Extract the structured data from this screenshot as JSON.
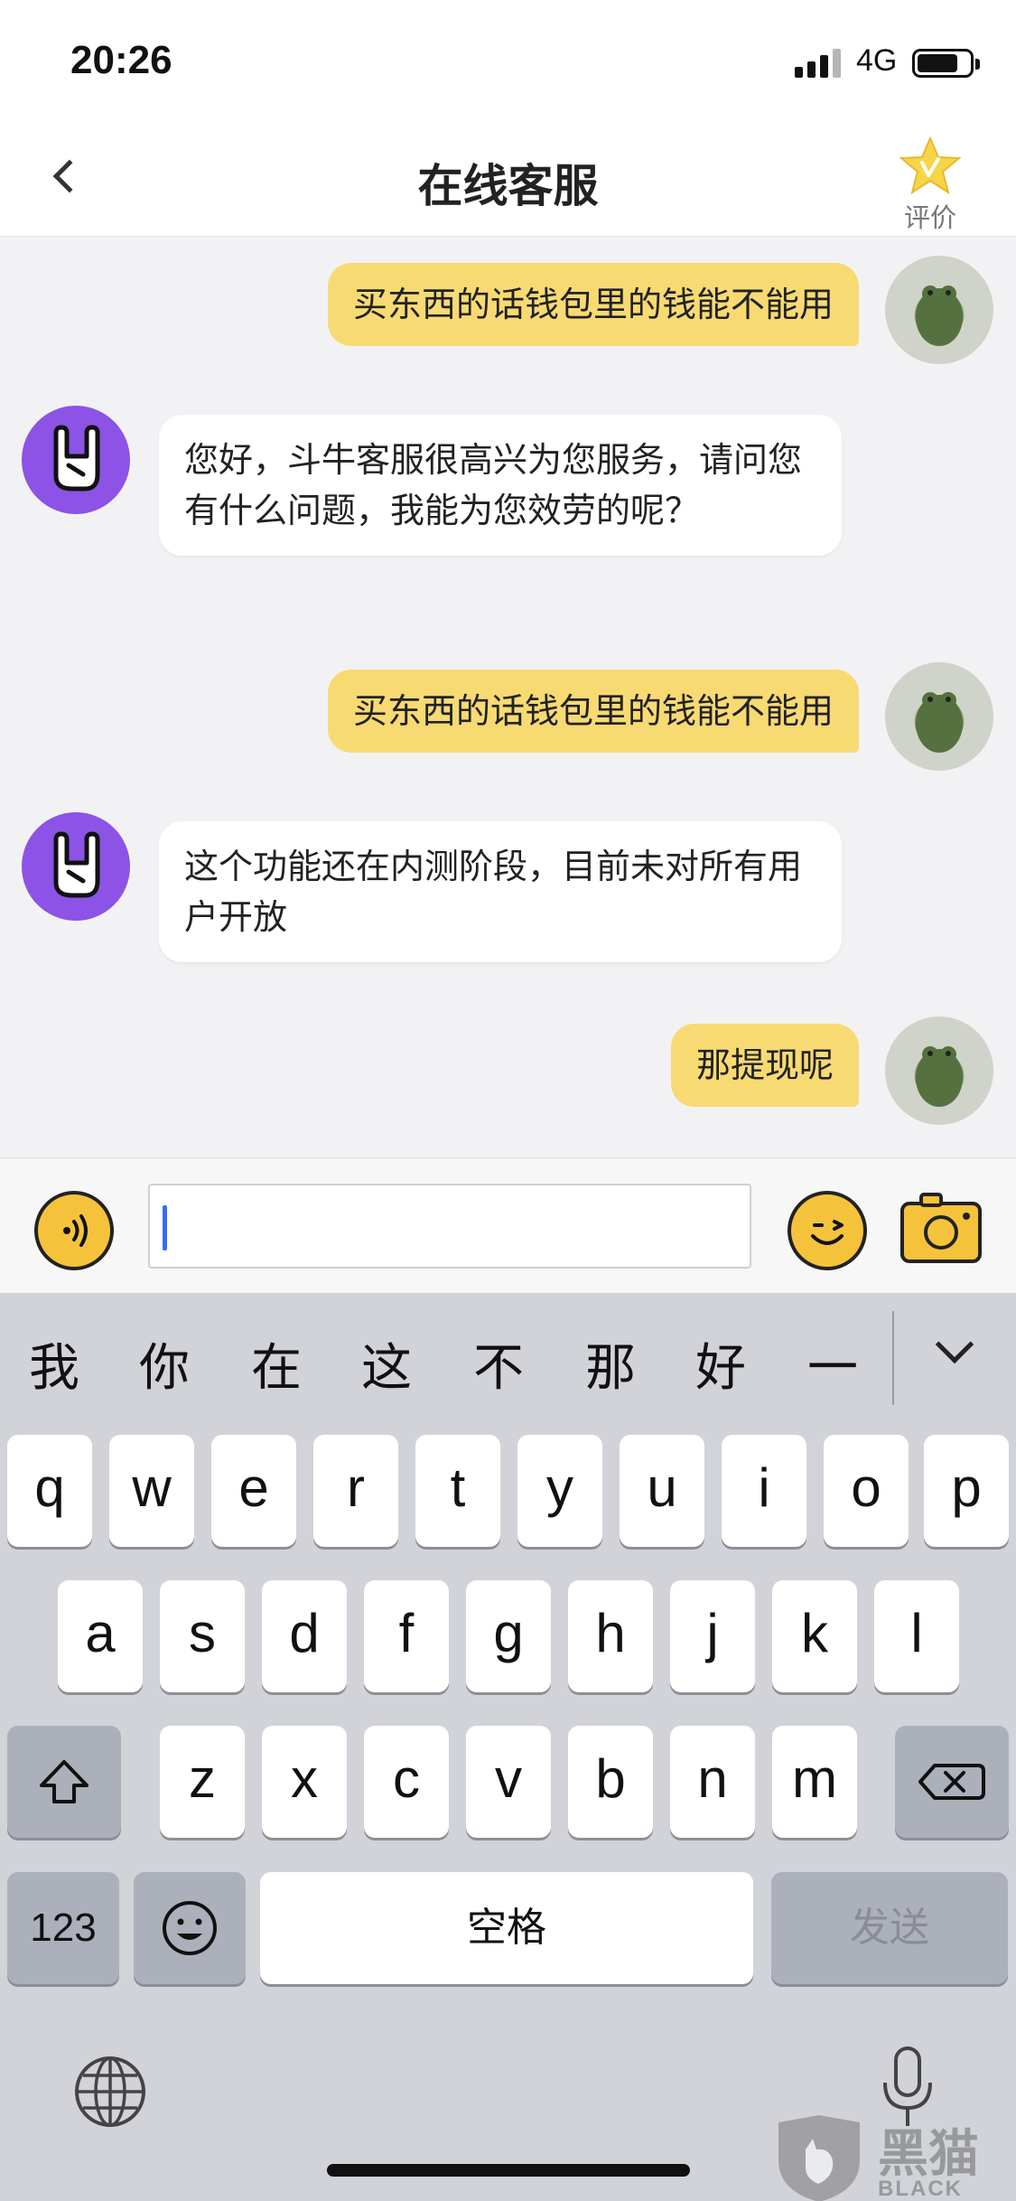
{
  "status_bar": {
    "time": "20:26",
    "network": "4G"
  },
  "nav": {
    "title": "在线客服",
    "rate_label": "评价"
  },
  "messages": [
    {
      "from": "user",
      "text": "买东西的话钱包里的钱能不能用"
    },
    {
      "from": "agent",
      "text": "您好，斗牛客服很高兴为您服务，请问您有什么问题，我能为您效劳的呢？"
    },
    {
      "from": "user",
      "text": "买东西的话钱包里的钱能不能用"
    },
    {
      "from": "agent",
      "text": "这个功能还在内测阶段，目前未对所有用户开放"
    },
    {
      "from": "user",
      "text": "那提现呢"
    }
  ],
  "input": {
    "value": ""
  },
  "keyboard": {
    "candidates": [
      "我",
      "你",
      "在",
      "这",
      "不",
      "那",
      "好",
      "一"
    ],
    "row1": [
      "q",
      "w",
      "e",
      "r",
      "t",
      "y",
      "u",
      "i",
      "o",
      "p"
    ],
    "row2": [
      "a",
      "s",
      "d",
      "f",
      "g",
      "h",
      "j",
      "k",
      "l"
    ],
    "row3": [
      "z",
      "x",
      "c",
      "v",
      "b",
      "n",
      "m"
    ],
    "numbers_label": "123",
    "space_label": "空格",
    "send_label": "发送"
  },
  "watermark": {
    "main": "黑猫",
    "sub": "BLACK CAT"
  },
  "colors": {
    "accent_yellow": "#f8da73",
    "agent_avatar": "#8c53e6",
    "caret": "#3a6cf0"
  }
}
